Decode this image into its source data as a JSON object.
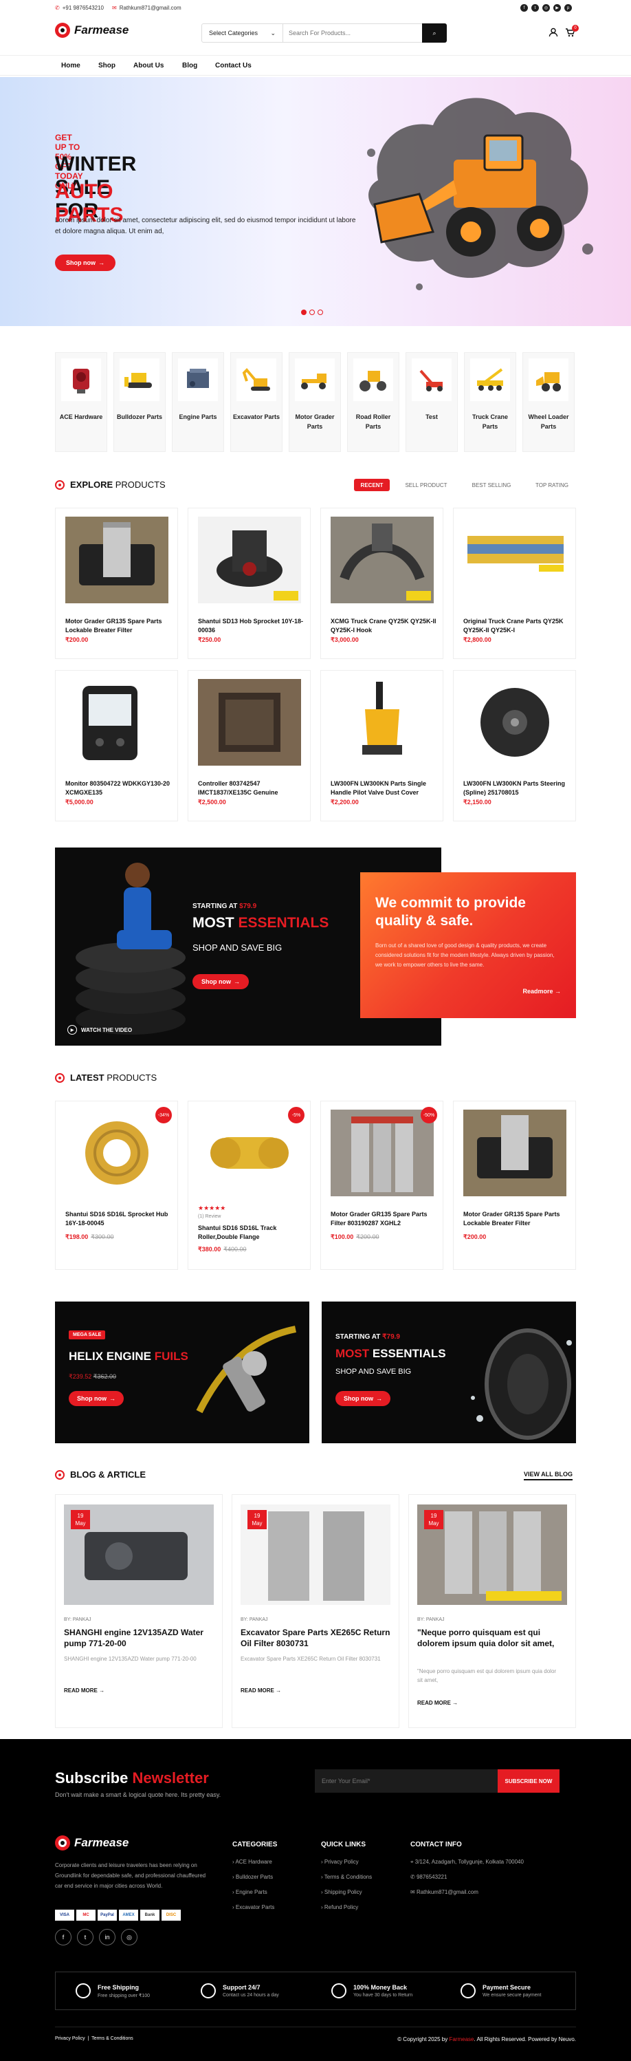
{
  "topbar": {
    "phone": "+91 9876543210",
    "email": "Rathkum871@gmail.com"
  },
  "header": {
    "brand": "Farmease",
    "category_label": "Select Categories",
    "search_placeholder": "Search For Products...",
    "cart_count": "0"
  },
  "nav": [
    "Home",
    "Shop",
    "About Us",
    "Blog",
    "Contact Us"
  ],
  "hero": {
    "pre": "GET UP TO 50% OFF TODAY ONLY!",
    "title1": "WINTER SALE FOR",
    "title2": "AUTO PARTS",
    "desc": "Lorem ipsum dolor sit amet, consectetur adipiscing elit, sed do eiusmod tempor incididunt ut labore et dolore magna aliqua. Ut enim ad,",
    "btn": "Shop now"
  },
  "categories": [
    {
      "label": "ACE Hardware"
    },
    {
      "label": "Bulldozer Parts"
    },
    {
      "label": "Engine Parts"
    },
    {
      "label": "Excavator Parts"
    },
    {
      "label": "Motor Grader Parts"
    },
    {
      "label": "Road Roller Parts"
    },
    {
      "label": "Test"
    },
    {
      "label": "Truck Crane Parts"
    },
    {
      "label": "Wheel Loader Parts"
    }
  ],
  "explore": {
    "title_bold": "EXPLORE",
    "title_rest": "PRODUCTS",
    "tabs": [
      "RECENT",
      "SELL PRODUCT",
      "BEST SELLING",
      "TOP RATING"
    ]
  },
  "products": [
    {
      "name": "Motor Grader GR135 Spare Parts Lockable Breater Filter",
      "price": "₹200.00"
    },
    {
      "name": "Shantui SD13 Hob Sprocket 10Y-18-00036",
      "price": "₹250.00"
    },
    {
      "name": "XCMG Truck Crane QY25K QY25K-II QY25K-I Hook",
      "price": "₹3,000.00"
    },
    {
      "name": "Original Truck Crane Parts QY25K QY25K-II QY25K-I",
      "price": "₹2,800.00"
    },
    {
      "name": "Monitor 803504722 WDKKGY130-20 XCMGXE135",
      "price": "₹5,000.00"
    },
    {
      "name": "Controller 803742547 IMCT1837/XE135C Genuine",
      "price": "₹2,500.00"
    },
    {
      "name": "LW300FN LW300KN Parts Single Handle Pilot Valve Dust Cover",
      "price": "₹2,200.00"
    },
    {
      "name": "LW300FN LW300KN Parts Steering (Spline) 251708015",
      "price": "₹2,150.00"
    }
  ],
  "promo": {
    "starting": "STARTING AT",
    "starting_price": "$79.9",
    "most": "MOST",
    "essentials": "ESSENTIALS",
    "shop_save": "SHOP AND SAVE BIG",
    "btn": "Shop now",
    "video": "WATCH THE VIDEO"
  },
  "commit": {
    "title": "We commit to provide quality & safe.",
    "desc": "Born out of a shared love of good design & quality products, we create considered solutions fit for the modern lifestyle. Always driven by passion, we work to empower others to live the same.",
    "link": "Readmore"
  },
  "latest": {
    "title_bold": "LATEST",
    "title_rest": "PRODUCTS"
  },
  "latest_products": [
    {
      "name": "Shantui SD16 SD16L Sprocket Hub 16Y-18-00045",
      "price": "₹198.00",
      "old": "₹300.00",
      "badge": "-34%"
    },
    {
      "name": "Shantui SD16 SD16L Track Roller,Double Flange",
      "price": "₹380.00",
      "old": "₹400.00",
      "badge": "-5%",
      "stars": "★★★★★",
      "review": "(1) Review"
    },
    {
      "name": "Motor Grader GR135 Spare Parts Filter 803190287 XGHL2",
      "price": "₹100.00",
      "old": "₹200.00",
      "badge": "-50%"
    },
    {
      "name": "Motor Grader GR135 Spare Parts Lockable Breater Filter",
      "price": "₹200.00"
    }
  ],
  "banners": [
    {
      "tag": "MEGA SALE",
      "t1": "HELIX ENGINE",
      "t2": "FUILS",
      "price": "₹239.52",
      "old": "₹362.00",
      "btn": "Shop now"
    },
    {
      "starting": "STARTING AT",
      "price": "₹79.9",
      "most": "MOST",
      "essentials": "ESSENTIALS",
      "shop_save": "SHOP AND SAVE BIG",
      "btn": "Shop now"
    }
  ],
  "blog": {
    "title": "BLOG & ARTICLE",
    "view_all": "VIEW ALL BLOG",
    "posts": [
      {
        "day": "19",
        "month": "May",
        "by": "BY: PANKAJ",
        "title": "SHANGHI engine 12V135AZD Water pump 771-20-00",
        "desc": "SHANGHI engine 12V135AZD Water pump 771-20-00",
        "rm": "READ MORE"
      },
      {
        "day": "19",
        "month": "May",
        "by": "BY: PANKAJ",
        "title": "Excavator Spare Parts XE265C Return Oil Filter 8030731",
        "desc": "Excavator Spare Parts XE265C Return Oil Filter 8030731",
        "rm": "READ MORE"
      },
      {
        "day": "19",
        "month": "May",
        "by": "BY: PANKAJ",
        "title": "\"Neque porro quisquam est qui dolorem ipsum quia dolor sit amet,",
        "desc": "\"Neque porro quisquam est qui dolorem ipsum quia dolor sit amet,",
        "rm": "READ MORE"
      }
    ]
  },
  "newsletter": {
    "t1": "Subscribe",
    "t2": "Newsletter",
    "sub": "Don't wait make a smart & logical quote here. Its pretty easy.",
    "placeholder": "Enter Your Email*",
    "btn": "SUBSCRIBE NOW"
  },
  "footer": {
    "about": "Corporate clients and leisure travelers has been relying on Groundlink for dependable safe, and professional chauffeured car end service in major cities across World.",
    "payments": [
      "VISA",
      "MC",
      "PayPal",
      "AMEX",
      "Bank",
      "DISC"
    ],
    "categories_title": "CATEGORIES",
    "categories": [
      "ACE Hardware",
      "Bulldozer Parts",
      "Engine Parts",
      "Excavator Parts"
    ],
    "links_title": "QUICK LINKS",
    "links": [
      "Privacy Policy",
      "Terms & Conditions",
      "Shipping Policy",
      "Refund Policy"
    ],
    "contact_title": "CONTACT INFO",
    "address": "3/124, Azadgarh, Tollygunje, Kolkata 700040",
    "phone": "9876543221",
    "email": "Rathkum871@gmail.com",
    "services": [
      {
        "t": "Free Shipping",
        "s": "Free shipping over ₹100"
      },
      {
        "t": "Support 24/7",
        "s": "Contact us 24 hours a day"
      },
      {
        "t": "100% Money Back",
        "s": "You have 30 days to Return"
      },
      {
        "t": "Payment Secure",
        "s": "We ensure secure payment"
      }
    ],
    "bottom_links": [
      "Privacy Policy",
      "Terms & Conditions"
    ],
    "copy_pre": "© Copyright 2025 by",
    "copy_brand": "Farmease",
    "copy_post": ". All Rights Reserved. Powered by Neuvo."
  },
  "colors": {
    "accent": "#e51c23",
    "dark": "#000000"
  }
}
